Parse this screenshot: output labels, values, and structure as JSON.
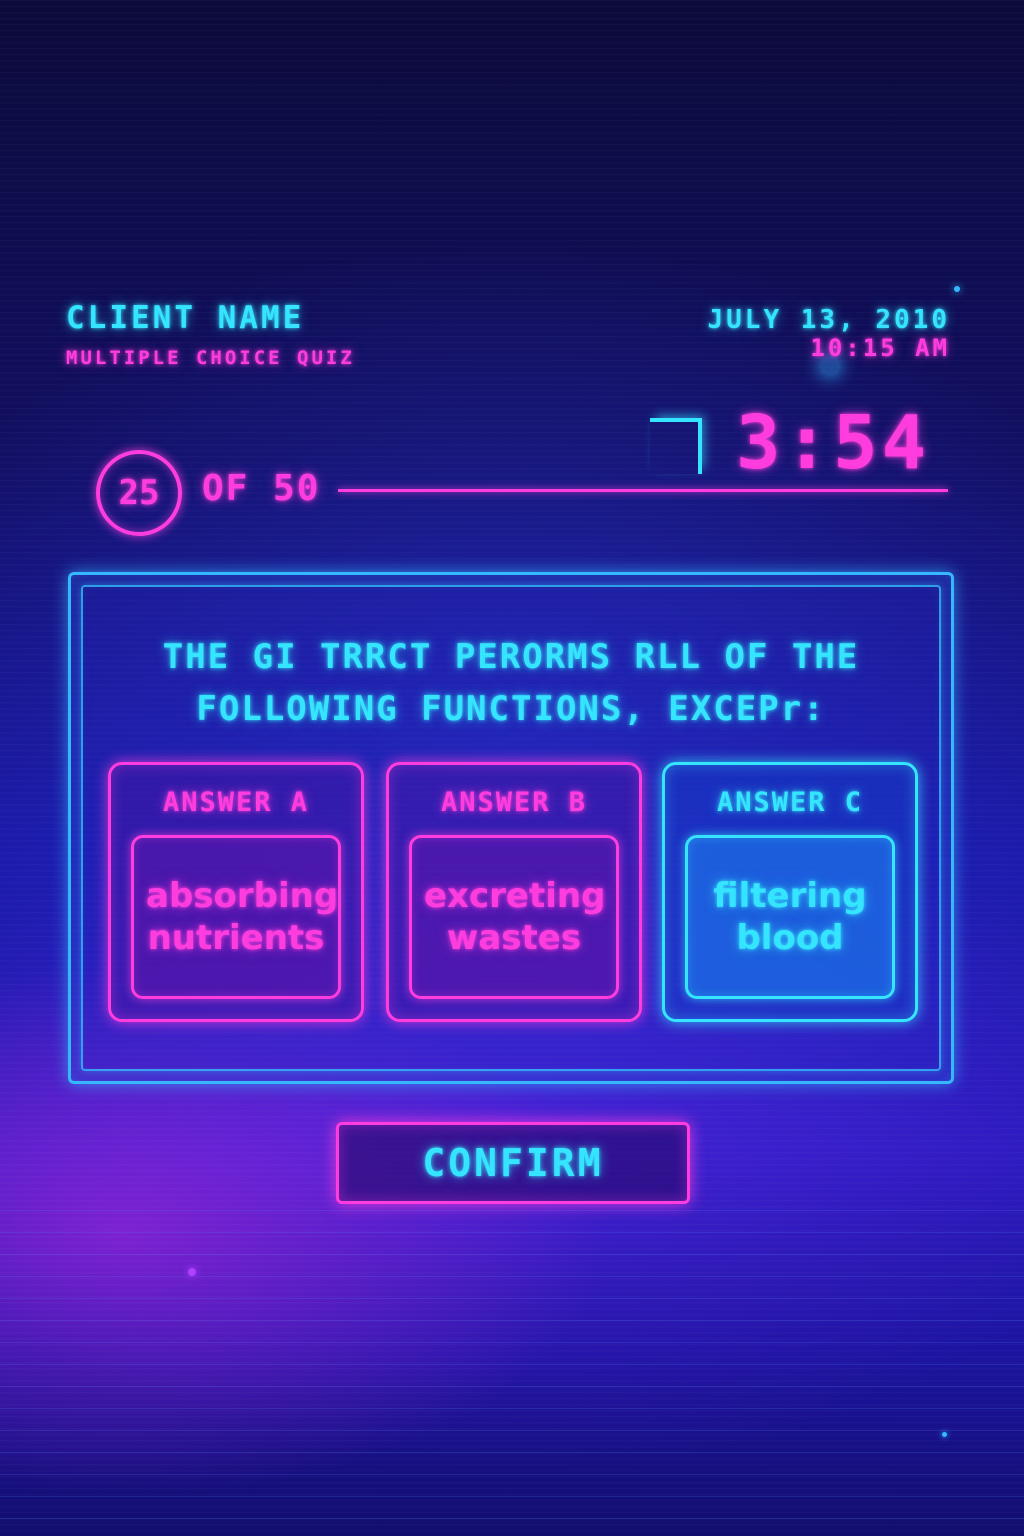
{
  "header": {
    "client_name": "CLIENT NAME",
    "quiz_type": "MULTIPLE CHOICE QUIZ",
    "date": "JULY 13, 2010",
    "time": "10:15 AM"
  },
  "timer": {
    "remaining": "3:54"
  },
  "progress": {
    "current": "25",
    "total_label": "OF 50"
  },
  "question": {
    "text": "THE GI TRRCT PERORMS RLL  OF  THE\n        FOLLOWING FUNCTIONS, EXCEPr:"
  },
  "answers": [
    {
      "label": "ANSWER  A",
      "text": "absorbing nutrients",
      "selected": false
    },
    {
      "label": "ANSWER  B",
      "text": "excreting wastes",
      "selected": false
    },
    {
      "label": "ANSWER  C",
      "text": "filtering blood",
      "selected": true
    }
  ],
  "actions": {
    "confirm_label": "CONFIRM"
  },
  "colors": {
    "accent_cyan": "#35e4ff",
    "accent_pink": "#ff3ddf",
    "background": "#1a18a6"
  }
}
